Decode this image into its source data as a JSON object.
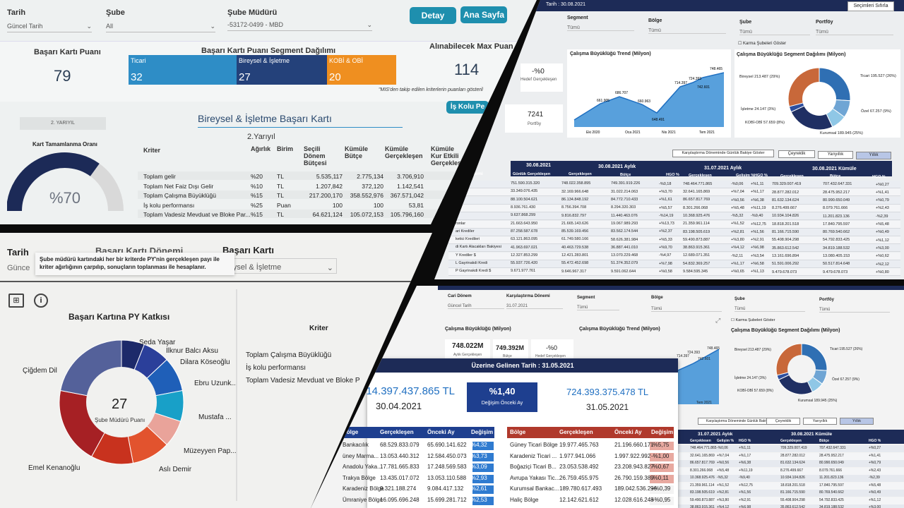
{
  "p1": {
    "filters": [
      {
        "label": "Tarih",
        "value": "Güncel Tarih"
      },
      {
        "label": "Şube",
        "value": "All"
      },
      {
        "label": "Şube Müdürü",
        "value": "-53172-0499 - MBD"
      }
    ],
    "buttons": {
      "detay": "Detay",
      "ana_sayfa": "Ana Sayfa",
      "is_kolu": "İş Kolu Pe"
    },
    "score_title": "Başarı Kartı Puanı",
    "score": "79",
    "segment_title": "Başarı Kartı Puanı Segment Dağılımı",
    "segments": [
      {
        "name": "Ticari",
        "value": "32",
        "color": "#2e8dc6"
      },
      {
        "name": "Bireysel & İşletme",
        "value": "27",
        "color": "#24417a"
      },
      {
        "name": "KOBİ & OBİ",
        "value": "20",
        "color": "#ef8f20"
      }
    ],
    "max_title": "Alınabilecek Max Puan",
    "max_value": "114",
    "footnote": "\"MIS'den takip edilen kriterlerin puanları gösteril",
    "year_tab": "2. YARIYIL",
    "card_title": "Bireysel & İşletme Başarı Kartı",
    "period": "2.Yarıyıl",
    "gauge_title": "Kart Tamamlanma Oranı",
    "gauge_value": "%70",
    "gauge_fraction": 0.7,
    "table_headers": [
      "Kriter",
      "Ağırlık",
      "Birim",
      "Seçili Dönem Bütçesi",
      "Kümüle Bütçe",
      "Kümüle Gerçekleşen",
      "Kümüle Kur Etkili Gerçekleşe"
    ],
    "rows": [
      [
        "Toplam gelir",
        "%20",
        "TL",
        "5.535,117",
        "2.775,134",
        "3.706,910",
        "3.70"
      ],
      [
        "Toplam Net Faiz Dışı Gelir",
        "%10",
        "TL",
        "1.207,842",
        "372,120",
        "1.142,541",
        "1.14"
      ],
      [
        "Toplam Çalışma Büyüklüğü",
        "%15",
        "TL",
        "217.200,170",
        "358.552,976",
        "367.571,042",
        "36"
      ],
      [
        "İş kolu performansı",
        "%25",
        "Puan",
        "100",
        "100",
        "53,81",
        ""
      ],
      [
        "Toplam Vadesiz Mevduat ve Bloke Par...",
        "%15",
        "TL",
        "64.621,124",
        "105.072,153",
        "105.796,160",
        ""
      ]
    ]
  },
  "p2": {
    "headers": [
      "Tarih",
      "Başarı Kartı Dönemi",
      "Başarı Kartı"
    ],
    "date_value": "Günce",
    "card_value": "reysel & İşletme",
    "tooltip": "Şube müdürü kartındaki her bir kriterde PY'nin gerçekleşen payı ile kriter ağırlığının çarpılıp, sonuçların toplanması ile hesaplanır.",
    "donut_title": "Başarı Kartına PY Katkısı",
    "donut_center": "27",
    "donut_center_label": "Şube Müdürü Puanı",
    "slices": [
      {
        "name": "Seda Yaşar",
        "color": "#1d2a6a"
      },
      {
        "name": "İlknur Balcı Aksu",
        "color": "#2b3f9a"
      },
      {
        "name": "Dilara Köseoğlu",
        "color": "#1f5fb8"
      },
      {
        "name": "Ebru Uzunk...",
        "color": "#18a0c8"
      },
      {
        "name": "Mustafa ...",
        "color": "#e9a39a"
      },
      {
        "name": "Müzeyyen Pap...",
        "color": "#e2532e"
      },
      {
        "name": "Aslı Demir",
        "color": "#c8321e"
      },
      {
        "name": "Emel Kenanoğlu",
        "color": "#a62024"
      },
      {
        "name": "Çiğdem Dil",
        "color": "#54619a"
      }
    ],
    "criteria_title": "Kriter",
    "criteria": [
      "Toplam Çalışma Büyüklüğü",
      "İş kolu performansı",
      "Toplam Vadesiz Mevduat ve Bloke P"
    ]
  },
  "p3": {
    "top_date": "Tarih : 30.08.2021",
    "clear_btn": "Seçimleri Sıfırla",
    "filters": [
      {
        "label": "Segment",
        "value": "Tümü"
      },
      {
        "label": "Bölge",
        "value": "Tümü"
      },
      {
        "label": "Şube",
        "value": "Tümü"
      },
      {
        "label": "Portföy",
        "value": "Tümü"
      }
    ],
    "closed_branches": "Karma Şubeleri Göster",
    "kpi1": {
      "value": "-%0",
      "label": "Hedef Gerçekleşen"
    },
    "kpi2": {
      "value": "7241",
      "label": "Portföy"
    },
    "trend_title": "Çalışma Büyüklüğü Trend (Milyon)",
    "trend_points": [
      "661.905",
      "686.707",
      "660.963",
      "648.491",
      "714.397",
      "724.393",
      "742.601",
      "748.465"
    ],
    "trend_axis": [
      "Eki 2020",
      "Oca 2021",
      "Nis 2021",
      "Tem 2021"
    ],
    "pie_title": "Çalışma Büyüklüğü Segment Dağılımı (Milyon)",
    "pie_labels": [
      "Bireysel 213.487 (29%)",
      "Ticari 195.527 (26%)",
      "İşletme 24.147 (3%)",
      "Özel 67.257 (9%)",
      "KOBİ-OBİ 57.659 (8%)",
      "Kurumsal 189.945 (25%)"
    ],
    "compare_btn": "Karşılaştırma Döneminde Günlük Bakiye Göster",
    "period_btns": [
      "Çeyreklik",
      "Yarıyıllık",
      "Yıllık"
    ],
    "hdr_groups": [
      "30.08.2021",
      "30.08.2021 Aylık",
      "31.07.2021 Aylık",
      "30.08.2021 Kümüle"
    ],
    "hdr_cols": [
      "Günlük Gerçekleşen",
      "Gerçekleşen",
      "Bütçe",
      "HGO %",
      "Gerçekleşen",
      "Gelişim %",
      "HGO %",
      "Gerçekleşen",
      "Bütçe",
      "HGO %"
    ],
    "first_col": "ge Kalemi",
    "rows": [
      [
        "",
        "751.590.315.320",
        "748.022.358.895",
        "749.391.919.226",
        "-%0,18",
        "748.464.771.865",
        "-%0,06",
        "+%1,11",
        "709.329.007.419",
        "707.432.647.331",
        "+%0,27"
      ],
      [
        "",
        "33.349.076.435",
        "32.169.966.648",
        "31.022.214.063",
        "+%3,70",
        "32.641.165.869",
        "+%7,04",
        "+%1,17",
        "28.877.282.012",
        "28.475.952.217",
        "+%1,41"
      ],
      [
        "",
        "88.100.504.621",
        "86.134.848.192",
        "84.772.710.433",
        "+%1,61",
        "86.657.817.769",
        "+%0,56",
        "+%6,38",
        "81.632.134.624",
        "80.990.650.049",
        "+%0,79"
      ],
      [
        "S",
        "8.936.761.430",
        "8.756.394.708",
        "8.294.320.303",
        "+%5,57",
        "8.301.266.068",
        "+%5,48",
        "+%11,19",
        "8.276.499.667",
        "8.079.761.666",
        "+%2,43"
      ],
      [
        "",
        "9.637.868.299",
        "9.816.832.797",
        "11.440.463.076",
        "-%14,19",
        "10.368.925.476",
        "-%5,32",
        "-%9,40",
        "10.934.104.826",
        "11.201.823.136",
        "-%2,39"
      ],
      [
        "ronlar",
        "21.663.643.950",
        "21.665.143.626",
        "19.067.989.293",
        "+%13,73",
        "21.359.961.114",
        "+%1,52",
        "+%12,75",
        "18.818.201.518",
        "17.840.795.597",
        "+%5,48"
      ],
      [
        "ari Krediler",
        "87.258.587.678",
        "85.539.169.456",
        "83.562.174.544",
        "+%2,37",
        "83.198.505.619",
        "+%2,81",
        "+%1,56",
        "81.166.715.590",
        "80.769.540.662",
        "+%0,49"
      ],
      [
        "ketici Kredileri",
        "63.121.863.095",
        "61.749.580.166",
        "58.626.381.984",
        "+%5,33",
        "59.490.873.887",
        "+%3,80",
        "+%2,91",
        "55.408.904.298",
        "54.792.833.425",
        "+%1,12"
      ],
      [
        "di Kartı Alacakları Bakiyesi",
        "41.963.697.021",
        "40.463.729.538",
        "36.887.441.010",
        "+%9,70",
        "38.863.915.361",
        "+%4,12",
        "+%6,98",
        "35.863.612.542",
        "34.819.188.532",
        "+%3,00"
      ],
      [
        "Y Krediler $",
        "12.327.853.299",
        "12.421.283.801",
        "13.070.229.468",
        "-%4,97",
        "12.689.071.351",
        "-%2,11",
        "+%3,54",
        "13.161.696.894",
        "13.080.405.153",
        "+%0,62"
      ],
      [
        "L Gayrinakdi Kredi",
        "55.937.726.420",
        "55.472.452.698",
        "51.374.352.079",
        "+%7,98",
        "54.832.369.257",
        "+%1,17",
        "+%6,58",
        "51.591.006.292",
        "50.517.814.648",
        "+%2,12"
      ],
      [
        "P Gayrinakdi Kredi $",
        "9.671.977.761",
        "9.646.967.317",
        "9.591.062.644",
        "+%0,58",
        "9.584.595.345",
        "+%0,65",
        "+%1,13",
        "9.479.678.073",
        "9.479.678.073",
        "+%0,80"
      ]
    ]
  },
  "p4": {
    "filters": [
      {
        "label": "Cari Dönem",
        "value": "Güncel Tarih"
      },
      {
        "label": "Karşılaştırma Dönemi",
        "value": "31.07.2021"
      },
      {
        "label": "Segment",
        "value": "Tümü"
      },
      {
        "label": "Bölge",
        "value": "Tümü"
      },
      {
        "label": "Şube",
        "value": "Tümü"
      },
      {
        "label": "Portföy",
        "value": "Tümü"
      }
    ],
    "kpi_title": "Çalışma Büyüklüğü (Milyon)",
    "kpis": [
      {
        "value": "748.022M",
        "label": "Aylık Gerçekleşen"
      },
      {
        "value": "749.392M",
        "label": "Bütçe"
      },
      {
        "value": "-%0",
        "label": "Hedef Gerçekleşen"
      }
    ],
    "trend_title": "Çalışma Büyüklüğü Trend (Milyon)",
    "trend_labels": [
      "714.397",
      "724.393",
      "742.601",
      "748.465"
    ],
    "trend_axis": "Tem 2021",
    "closed_branches": "Karma Şubeleri Göster",
    "pie_title": "Çalışma Büyüklüğü Segment Dağılımı (Milyon)",
    "pie_labels": [
      "Bireysel 213.487 (29%)",
      "Ticari 195.527 (26%)",
      "İşletme 24.147 (3%)",
      "Özel 67.257 (9%)",
      "KOBİ-OBİ 57.659 (8%)",
      "Kurumsal 189.945 (25%)"
    ],
    "compare_btn": "Karşılaştırma Döneminde Günlük Bakiye Göster",
    "period_btns": [
      "Çeyreklik",
      "Yarıyıllık",
      "Yıllık"
    ],
    "popup_title": "Üzerine Gelinen Tarih : 31.05.2021",
    "popup_left_value": "714.397.437.865 TL",
    "popup_left_date": "30.04.2021",
    "popup_pct": "%1,40",
    "popup_pct_label": "Değişim Önceki Ay",
    "popup_right_value": "724.393.375.478 TL",
    "popup_right_date": "31.05.2021",
    "left_headers": [
      "Bölge",
      "Gerçekleşen",
      "Önceki Ay",
      "Değişim"
    ],
    "left_rows": [
      [
        "Bankacılık",
        "68.529.833.079",
        "65.690.141.622",
        "%4,32"
      ],
      [
        "üney Marma...",
        "13.053.440.312",
        "12.584.450.073",
        "%3,73"
      ],
      [
        "Anadolu Yaka...",
        "17.781.665.833",
        "17.248.569.583",
        "%3,09"
      ],
      [
        "Trakya Bölge",
        "13.435.017.072",
        "13.053.110.588",
        "%2,93"
      ],
      [
        "Karadeniz Bölge",
        "9.321.188.274",
        "9.084.417.132",
        "%2,61"
      ],
      [
        "Ümraniye Bölge",
        "16.095.696.248",
        "15.699.281.712",
        "%2,53"
      ]
    ],
    "right_headers": [
      "Bölge",
      "Gerçekleşen",
      "Önceki Ay",
      "Değişim"
    ],
    "right_rows": [
      [
        "Güney Ticari Bölge",
        "19.977.465.763",
        "21.196.660.171",
        "-%5,75"
      ],
      [
        "Karadeniz Ticari ...",
        "1.977.941.066",
        "1.997.922.992",
        "-%1,00"
      ],
      [
        "Boğaziçi Ticari B...",
        "23.053.538.492",
        "23.208.943.827",
        "-%0,67"
      ],
      [
        "Avrupa Yakası Tic...",
        "26.759.455.975",
        "26.790.159.389",
        "-%0,11"
      ],
      [
        "Kurumsal Bankac...",
        "189.780.617.493",
        "189.042.536.296",
        "+%0,39"
      ],
      [
        "Haliç Bölge",
        "12.142.621.612",
        "12.028.616.248",
        "+%0,95"
      ]
    ],
    "tbl_groups": [
      "31.07.2021 Aylık",
      "30.08.2021 Kümüle"
    ],
    "tbl_cols": [
      "Gerçeklesen",
      "Gelişim %",
      "HGO %",
      "Gerçekleşen",
      "Bütçe",
      "HGO %"
    ],
    "tbl_rows": [
      [
        "748.464.771.865",
        "-%0,06",
        "+%1,11",
        "709.329.007.419",
        "707.432.647.331",
        "+%0,27"
      ],
      [
        "32.641.165.869",
        "+%7,04",
        "+%1,17",
        "28.877.282.012",
        "28.475.952.217",
        "+%1,41"
      ],
      [
        "86.657.817.769",
        "+%0,56",
        "+%6,38",
        "81.632.134.624",
        "80.990.650.049",
        "+%0,79"
      ],
      [
        "8.301.266.068",
        "+%5,48",
        "+%11,19",
        "8.276.499.667",
        "8.079.761.666",
        "+%2,43"
      ],
      [
        "10.368.925.476",
        "-%5,32",
        "-%9,40",
        "10.934.104.826",
        "11.201.823.136",
        "-%2,39"
      ],
      [
        "21.359.961.114",
        "+%1,52",
        "+%12,75",
        "18.818.201.518",
        "17.840.795.597",
        "+%5,48"
      ],
      [
        "83.198.505.619",
        "+%2,81",
        "+%1,56",
        "81.166.715.590",
        "80.769.540.662",
        "+%0,49"
      ],
      [
        "59.490.873.887",
        "+%3,80",
        "+%2,91",
        "55.408.904.298",
        "54.792.833.425",
        "+%1,12"
      ],
      [
        "38.863.915.361",
        "+%4,12",
        "+%6,98",
        "35.863.612.542",
        "34.819.188.532",
        "+%3,00"
      ]
    ]
  }
}
